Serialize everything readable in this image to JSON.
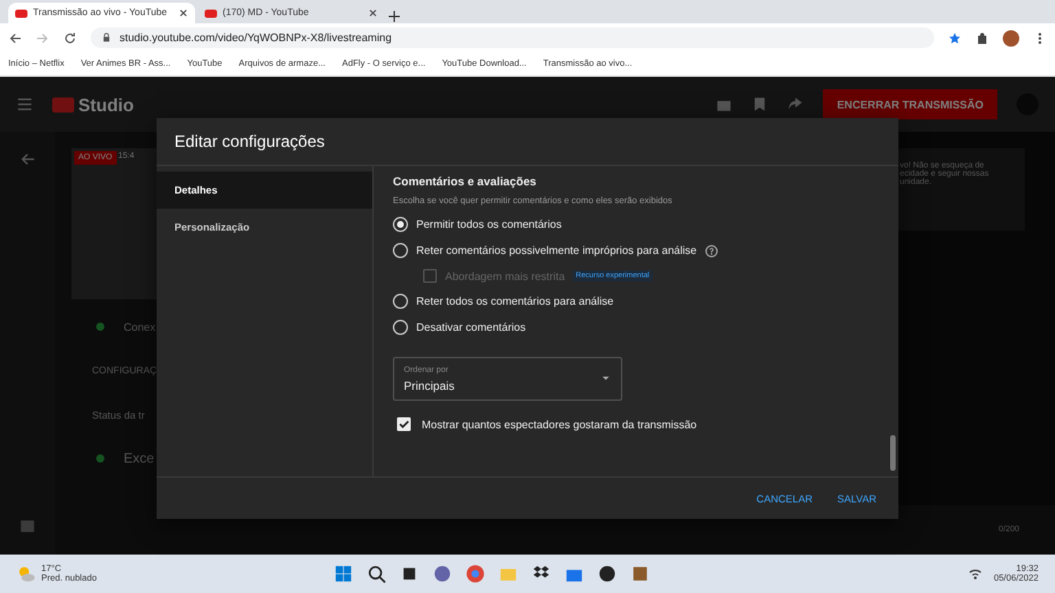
{
  "browser": {
    "tabs": [
      {
        "title": "Transmissão ao vivo - YouTube",
        "selected": true
      },
      {
        "title": "(170) MD - YouTube",
        "selected": false
      }
    ],
    "url": "studio.youtube.com/video/YqWOBNPx-X8/livestreaming",
    "bookmarks": [
      "Início – Netflix",
      "Ver Animes BR - Ass...",
      "YouTube",
      "Arquivos de armaze...",
      "AdFly - O serviço e...",
      "YouTube Download...",
      "Transmissão ao vivo..."
    ]
  },
  "studio": {
    "logo": "Studio",
    "end_button": "ENCERRAR TRANSMISSÃO"
  },
  "background": {
    "live_badge": "AO VIVO",
    "time": "15:4",
    "items": [
      "Conex",
      "CONFIGURAÇ",
      "Status da tr",
      "Exce"
    ],
    "chat_lines": [
      "vo! Não se esqueça de",
      "ecidade e seguir nossas",
      "unidade."
    ],
    "counter": "0/200"
  },
  "dialog": {
    "title": "Editar configurações",
    "nav": [
      {
        "label": "Detalhes",
        "selected": true
      },
      {
        "label": "Personalização",
        "selected": false
      }
    ],
    "section_title": "Comentários e avaliações",
    "description": "Escolha se você quer permitir comentários e como eles serão exibidos",
    "options": [
      {
        "label": "Permitir todos os comentários",
        "selected": true
      },
      {
        "label": "Reter comentários possivelmente impróprios para análise",
        "selected": false,
        "help": true
      },
      {
        "label": "Reter todos os comentários para análise",
        "selected": false
      },
      {
        "label": "Desativar comentários",
        "selected": false
      }
    ],
    "sub_option": {
      "label": "Abordagem mais restrita",
      "badge": "Recurso experimental",
      "checked": false
    },
    "sort": {
      "label": "Ordenar por",
      "value": "Principais"
    },
    "like_checkbox": {
      "label": "Mostrar quantos espectadores gostaram da transmissão",
      "checked": true
    },
    "buttons": [
      "CANCELAR",
      "SALVAR"
    ]
  },
  "taskbar": {
    "temperature": "17°C",
    "weather": "Pred. nublado",
    "time": "19:32",
    "date": "05/06/2022"
  }
}
